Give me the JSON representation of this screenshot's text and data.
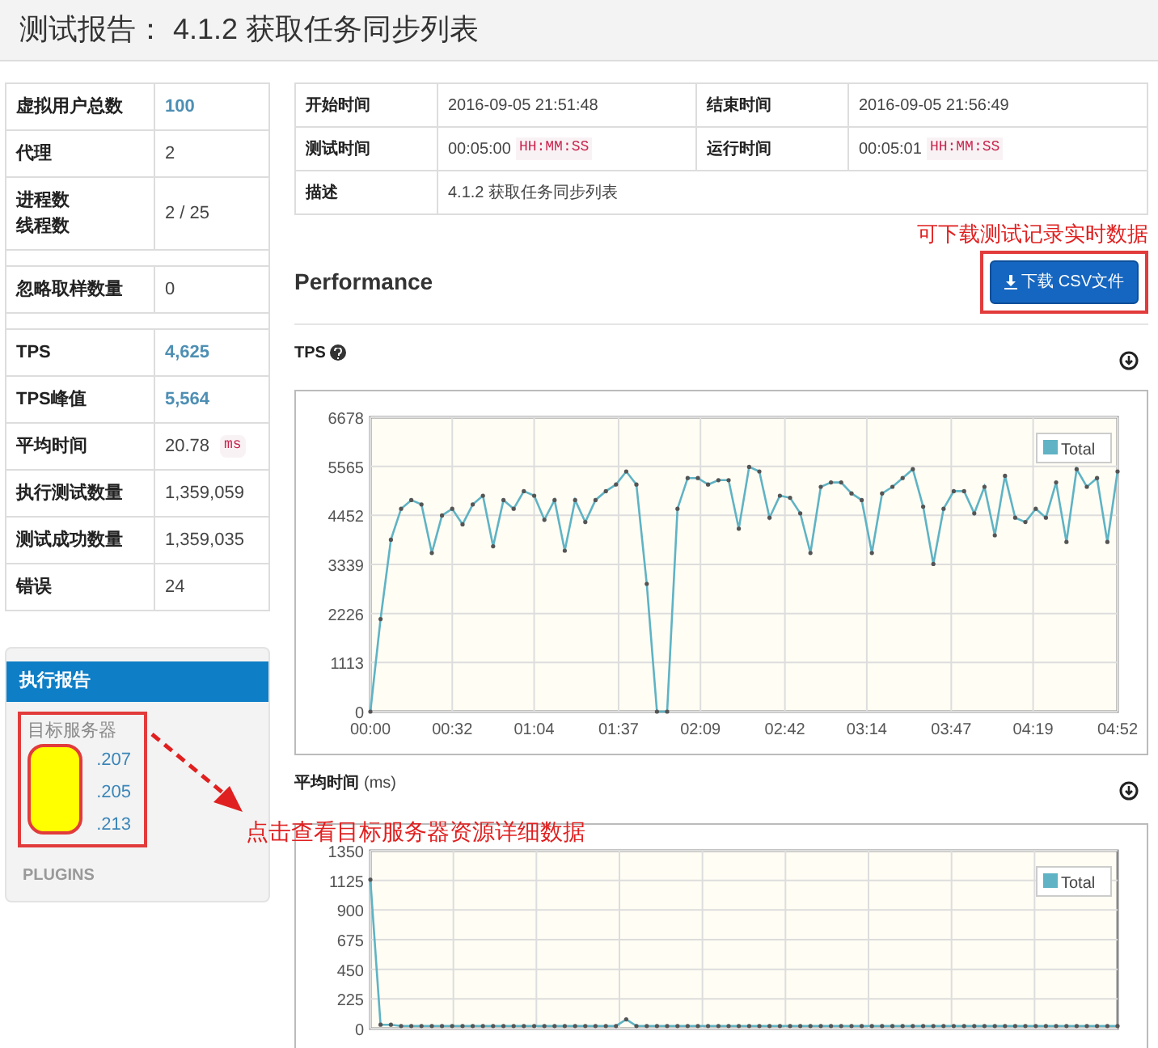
{
  "header": {
    "title": "测试报告： 4.1.2 获取任务同步列表"
  },
  "summary": [
    {
      "kind": "row",
      "label": "虚拟用户总数",
      "value": "100",
      "highlight": true
    },
    {
      "kind": "row",
      "label": "代理",
      "value": "2",
      "highlight": false
    },
    {
      "kind": "row",
      "label": "进程数",
      "sublabel": "线程数",
      "value": "2 / 25",
      "highlight": false
    },
    {
      "kind": "spacer"
    },
    {
      "kind": "row",
      "label": "忽略取样数量",
      "value": "0",
      "highlight": false
    },
    {
      "kind": "spacer"
    },
    {
      "kind": "row",
      "label": "TPS",
      "value": "4,625",
      "highlight": true
    },
    {
      "kind": "row",
      "label": "TPS峰值",
      "value": "5,564",
      "highlight": true
    },
    {
      "kind": "row",
      "label": "平均时间",
      "value": "20.78",
      "unit": "ms",
      "highlight": false
    },
    {
      "kind": "row",
      "label": "执行测试数量",
      "value": "1,359,059",
      "highlight": false
    },
    {
      "kind": "row",
      "label": "测试成功数量",
      "value": "1,359,035",
      "highlight": false
    },
    {
      "kind": "row",
      "label": "错误",
      "value": "24",
      "highlight": false
    }
  ],
  "report_panel": {
    "title": "执行报告",
    "section": "目标服务器",
    "servers": [
      ".207",
      ".205",
      ".213"
    ],
    "plugins": "PLUGINS"
  },
  "info": [
    {
      "label": "开始时间",
      "value": "2016-09-05 21:51:48",
      "label2": "结束时间",
      "value2": "2016-09-05 21:56:49"
    },
    {
      "label": "测试时间",
      "value": "00:05:00",
      "unit": "HH:MM:SS",
      "label2": "运行时间",
      "value2": "00:05:01",
      "unit2": "HH:MM:SS"
    },
    {
      "label": "描述",
      "value": "4.1.2 获取任务同步列表"
    }
  ],
  "annotations": [
    "可下载测试记录实时数据",
    "点击查看目标服务器资源详细数据"
  ],
  "performance": {
    "title": "Performance",
    "download_button": "下载 CSV文件"
  },
  "charts": [
    {
      "title": "TPS",
      "help": true,
      "chart_data": {
        "type": "line",
        "x": [
          0,
          4,
          8,
          12,
          16,
          20,
          24,
          28,
          32,
          36,
          40,
          44,
          48,
          52,
          56,
          60,
          64,
          68,
          72,
          76,
          80,
          84,
          88,
          92,
          96,
          100,
          104,
          108,
          112,
          116,
          120,
          124,
          128,
          132,
          136,
          140,
          144,
          148,
          152,
          156,
          160,
          164,
          168,
          172,
          176,
          180,
          184,
          188,
          192,
          196,
          200,
          204,
          208,
          212,
          216,
          220,
          224,
          228,
          232,
          236,
          240,
          244,
          248,
          252,
          256,
          260,
          264,
          268,
          272,
          276,
          280,
          284,
          288,
          292
        ],
        "series": [
          {
            "name": "Total",
            "color": "#5fb3c4",
            "values": [
              0,
              2100,
              3900,
              4600,
              4800,
              4700,
              3600,
              4450,
              4600,
              4250,
              4700,
              4900,
              3750,
              4800,
              4600,
              5000,
              4900,
              4350,
              4800,
              3650,
              4800,
              4300,
              4800,
              5000,
              5150,
              5450,
              5150,
              2900,
              0,
              0,
              4600,
              5300,
              5300,
              5150,
              5250,
              5250,
              4150,
              5550,
              5450,
              4400,
              4900,
              4850,
              4500,
              3600,
              5100,
              5200,
              5200,
              4950,
              4800,
              3600,
              4950,
              5100,
              5300,
              5500,
              4650,
              3350,
              4600,
              5000,
              5000,
              4500,
              5100,
              4000,
              5350,
              4400,
              4300,
              4600,
              4400,
              5200,
              3850,
              5500,
              5100,
              5300,
              3850,
              5450
            ]
          }
        ],
        "xlim": [
          0,
          292
        ],
        "ylim": [
          0,
          6678
        ],
        "grid": true,
        "xticks": [
          {
            "value": 0,
            "label": "00:00"
          },
          {
            "value": 32,
            "label": "00:32"
          },
          {
            "value": 64,
            "label": "01:04"
          },
          {
            "value": 97,
            "label": "01:37"
          },
          {
            "value": 129,
            "label": "02:09"
          },
          {
            "value": 162,
            "label": "02:42"
          },
          {
            "value": 194,
            "label": "03:14"
          },
          {
            "value": 227,
            "label": "03:47"
          },
          {
            "value": 259,
            "label": "04:19"
          },
          {
            "value": 292,
            "label": "04:52"
          }
        ],
        "yticks": [
          0,
          1113,
          2226,
          3339,
          4452,
          5565,
          6678
        ]
      }
    },
    {
      "title": "平均时间",
      "unit": "(ms)",
      "chart_data": {
        "type": "line",
        "x": [
          0,
          4,
          8,
          12,
          16,
          20,
          24,
          28,
          32,
          36,
          40,
          44,
          48,
          52,
          56,
          60,
          64,
          68,
          72,
          76,
          80,
          84,
          88,
          92,
          96,
          100,
          104,
          108,
          112,
          116,
          120,
          124,
          128,
          132,
          136,
          140,
          144,
          148,
          152,
          156,
          160,
          164,
          168,
          172,
          176,
          180,
          184,
          188,
          192,
          196,
          200,
          204,
          208,
          212,
          216,
          220,
          224,
          228,
          232,
          236,
          240,
          244,
          248,
          252,
          256,
          260,
          264,
          268,
          272,
          276,
          280,
          284,
          288,
          292
        ],
        "series": [
          {
            "name": "Total",
            "color": "#5fb3c4",
            "values": [
              1130,
              30,
              30,
              20,
              20,
              20,
              20,
              20,
              20,
              20,
              20,
              20,
              20,
              20,
              20,
              20,
              20,
              20,
              20,
              20,
              20,
              20,
              20,
              20,
              20,
              70,
              20,
              20,
              20,
              20,
              20,
              20,
              20,
              20,
              20,
              20,
              20,
              20,
              20,
              20,
              20,
              20,
              20,
              20,
              20,
              20,
              20,
              20,
              20,
              20,
              20,
              20,
              20,
              20,
              20,
              20,
              20,
              20,
              20,
              20,
              20,
              20,
              20,
              20,
              20,
              20,
              20,
              20,
              20,
              20,
              20,
              20,
              20,
              20
            ]
          }
        ],
        "xlim": [
          0,
          292
        ],
        "ylim": [
          0,
          1350
        ],
        "grid": true,
        "yticks": [
          0,
          225,
          450,
          675,
          900,
          1125,
          1350
        ]
      }
    }
  ]
}
